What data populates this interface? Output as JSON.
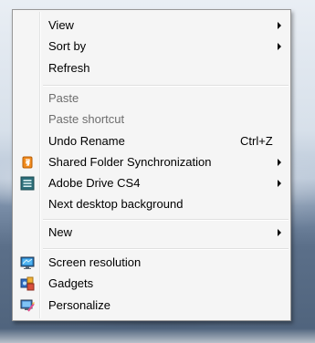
{
  "context_menu": {
    "items": [
      {
        "label": "View",
        "submenu": true
      },
      {
        "label": "Sort by",
        "submenu": true
      },
      {
        "label": "Refresh"
      },
      {
        "label": "Paste",
        "disabled": true
      },
      {
        "label": "Paste shortcut",
        "disabled": true
      },
      {
        "label": "Undo Rename",
        "shortcut": "Ctrl+Z"
      },
      {
        "label": "Shared Folder Synchronization",
        "submenu": true,
        "icon": "shared-folder-sync-icon"
      },
      {
        "label": "Adobe Drive CS4",
        "submenu": true,
        "icon": "adobe-drive-icon"
      },
      {
        "label": "Next desktop background"
      },
      {
        "label": "New",
        "submenu": true
      },
      {
        "label": "Screen resolution",
        "icon": "screen-resolution-icon"
      },
      {
        "label": "Gadgets",
        "icon": "gadgets-icon"
      },
      {
        "label": "Personalize",
        "icon": "personalize-icon"
      }
    ]
  },
  "colors": {
    "menu_bg": "#f5f5f5",
    "border": "#979797",
    "disabled_text": "#6d6d6d",
    "sync_orange": "#f08a1c",
    "adobe_teal": "#2d6f7a"
  }
}
